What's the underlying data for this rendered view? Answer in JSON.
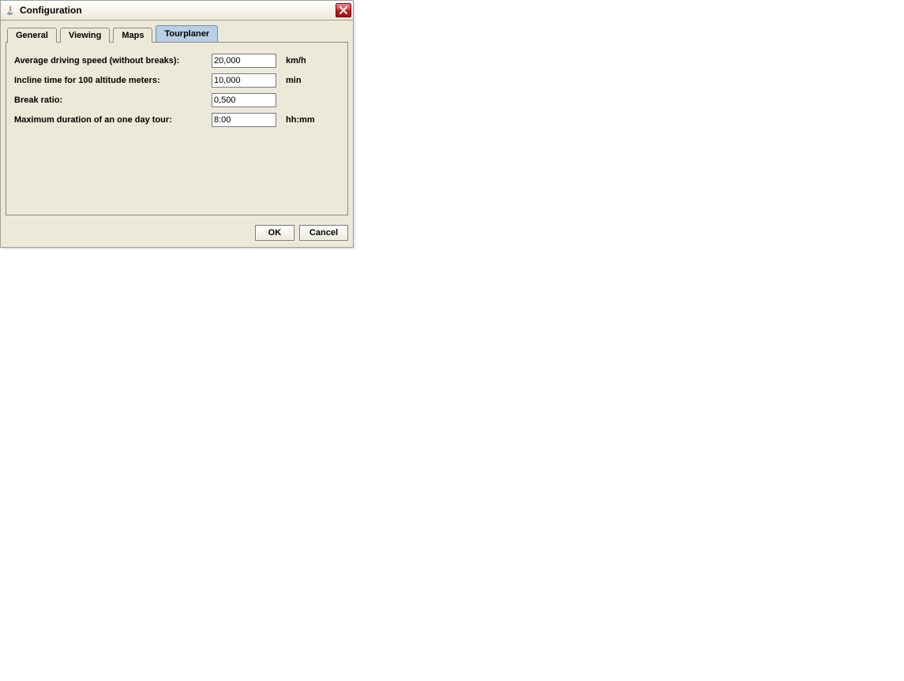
{
  "window": {
    "title": "Configuration"
  },
  "tabs": {
    "general": "General",
    "viewing": "Viewing",
    "maps": "Maps",
    "tourplaner": "Tourplaner"
  },
  "form": {
    "avg_speed": {
      "label": "Average driving speed (without breaks):",
      "value": "20,000",
      "unit": "km/h"
    },
    "incline": {
      "label": "Incline time for 100 altitude meters:",
      "value": "10,000",
      "unit": "min"
    },
    "break_ratio": {
      "label": "Break ratio:",
      "value": "0,500",
      "unit": ""
    },
    "max_duration": {
      "label": "Maximum duration of an one day tour:",
      "value": "8:00",
      "unit": "hh:mm"
    }
  },
  "buttons": {
    "ok": "OK",
    "cancel": "Cancel"
  }
}
